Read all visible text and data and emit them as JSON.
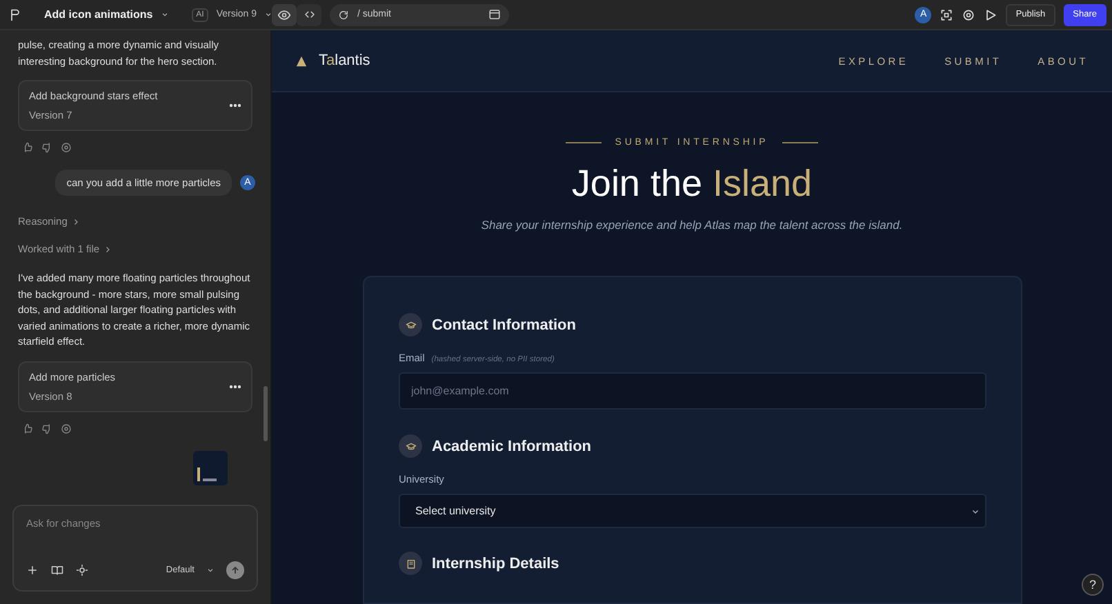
{
  "topbar": {
    "project": "Add icon animations",
    "ai_badge": "AI",
    "version": "Version 9",
    "path": "/ submit",
    "avatar": "A",
    "publish": "Publish",
    "share": "Share"
  },
  "chat": {
    "items": [
      {
        "kind": "text",
        "text": "pulse, creating a more dynamic and visually interesting background for the hero section."
      },
      {
        "kind": "card",
        "title": "Add background stars effect",
        "subtitle": "Version 7"
      },
      {
        "kind": "feedback"
      },
      {
        "kind": "user",
        "text": "can you add a little more particles",
        "avatar": "A"
      },
      {
        "kind": "link",
        "text": "Reasoning"
      },
      {
        "kind": "link",
        "text": "Worked with 1 file"
      },
      {
        "kind": "text",
        "text": "I've added many more floating particles throughout the background - more stars, more small pulsing dots, and additional larger floating particles with varied animations to create a richer, more dynamic starfield effect."
      },
      {
        "kind": "card",
        "title": "Add more particles",
        "subtitle": "Version 8"
      },
      {
        "kind": "feedback"
      },
      {
        "kind": "image"
      }
    ],
    "composer": {
      "placeholder": "Ask for changes",
      "mode": "Default"
    }
  },
  "site": {
    "brand": {
      "before": "T",
      "accent": "a",
      "after": "lantis"
    },
    "nav": [
      "EXPLORE",
      "SUBMIT",
      "ABOUT"
    ],
    "eyebrow": "SUBMIT INTERNSHIP",
    "headline": {
      "plain": "Join the",
      "accent": "Island"
    },
    "subtitle": "Share your internship experience and help Atlas map the talent across the island.",
    "sections": [
      {
        "title": "Contact Information",
        "field": {
          "kind": "input",
          "label": "Email",
          "hint": "(hashed server-side, no PII stored)",
          "placeholder": "john@example.com"
        }
      },
      {
        "title": "Academic Information",
        "field": {
          "kind": "select",
          "label": "University",
          "value": "Select university"
        }
      },
      {
        "title": "Internship Details"
      }
    ]
  },
  "help": "?"
}
